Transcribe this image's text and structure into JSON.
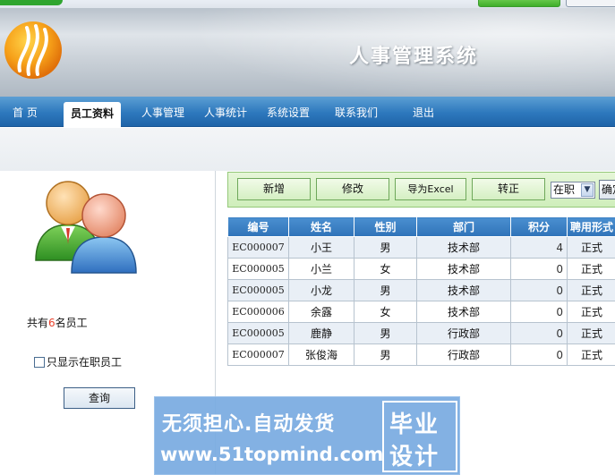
{
  "header": {
    "title": "人事管理系统"
  },
  "nav": {
    "items": [
      "首 页",
      "员工资料",
      "人事管理",
      "人事统计",
      "系统设置",
      "联系我们",
      "退出"
    ],
    "active_index": 1
  },
  "left_panel": {
    "count_prefix": "共有",
    "count_value": "6",
    "count_suffix": "名员工",
    "only_active_label": "只显示在职员工",
    "query_button": "查询"
  },
  "toolbar": {
    "buttons": [
      "新增",
      "修改",
      "导为Excel",
      "转正"
    ],
    "status_select": "在职",
    "confirm_label": "确定"
  },
  "table": {
    "headers": [
      "编号",
      "姓名",
      "性别",
      "部门",
      "积分",
      "聘用形式"
    ],
    "rows": [
      [
        "EC000007",
        "小王",
        "男",
        "技术部",
        "4",
        "正式"
      ],
      [
        "EC000005",
        "小兰",
        "女",
        "技术部",
        "0",
        "正式"
      ],
      [
        "EC000005",
        "小龙",
        "男",
        "技术部",
        "0",
        "正式"
      ],
      [
        "EC000006",
        "余露",
        "女",
        "技术部",
        "0",
        "正式"
      ],
      [
        "EC000005",
        "鹿静",
        "男",
        "行政部",
        "0",
        "正式"
      ],
      [
        "EC000007",
        "张俊海",
        "男",
        "行政部",
        "0",
        "正式"
      ]
    ]
  },
  "watermark": {
    "line1": "无须担心.自动发货",
    "line2": "www.51topmind.com",
    "box_top": "毕业",
    "box_bottom": "设计"
  },
  "colors": {
    "nav": "#2d78bd",
    "table_header": "#3a7fc2",
    "toolbar_bg": "#d9f2c6",
    "count_highlight": "#e8402a"
  }
}
